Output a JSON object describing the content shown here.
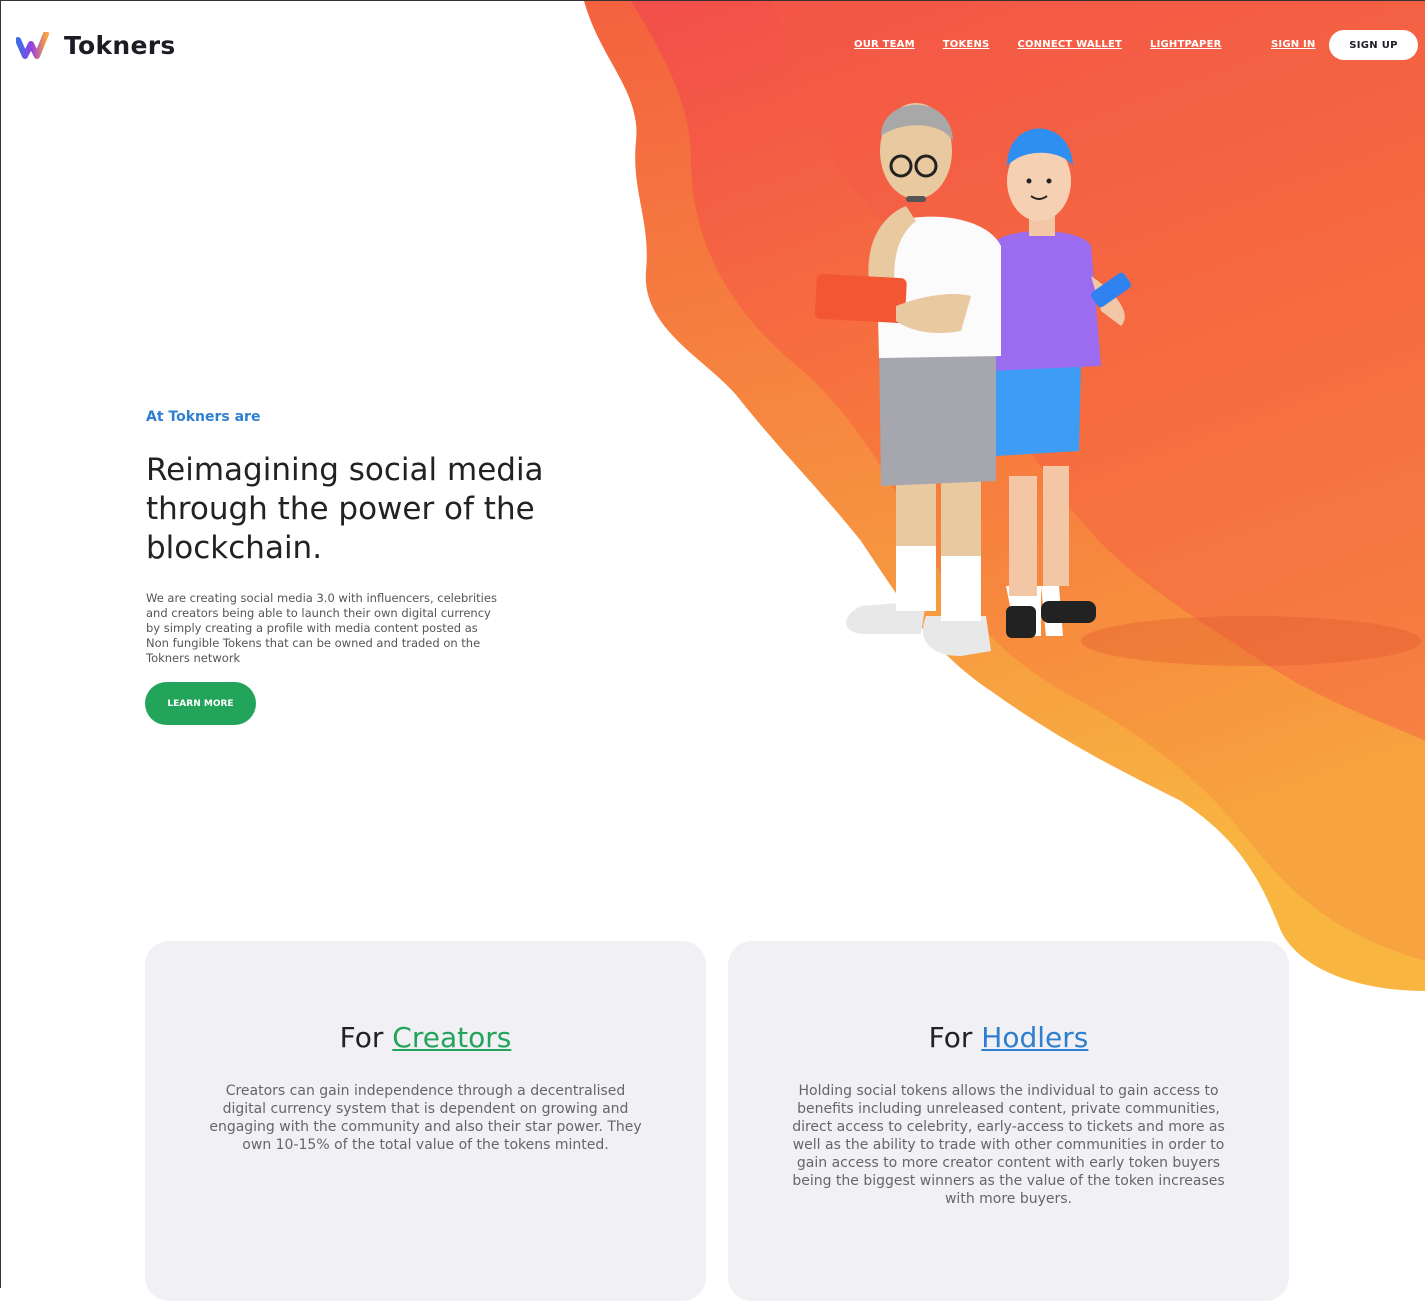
{
  "brand": {
    "name": "Tokners",
    "accent": "#22a45a",
    "blue": "#2f7fd1",
    "orange_top": "#f2544a",
    "orange_bottom": "#f7b13f"
  },
  "nav": {
    "items": [
      "OUR TEAM",
      "TOKENS",
      "CONNECT WALLET",
      "LIGHTPAPER"
    ],
    "sign_in": "SIGN IN",
    "sign_up": "SIGN UP"
  },
  "hero": {
    "eyebrow": "At Tokners are",
    "headline": "Reimagining social media through the power of the blockchain.",
    "description": "We are creating social media 3.0 with influencers, celebrities and creators being able to launch their own digital currency by simply creating a profile with media content posted as Non fungible Tokens that can be owned and traded on the Tokners network",
    "cta": "LEARN MORE",
    "illustration": "two-people-with-devices-illustration"
  },
  "cards": [
    {
      "prefix": "For",
      "highlight": "Creators",
      "body": "Creators can gain independence through a decentralised digital currency system that is dependent on growing and engaging with the community and also their star power. They own 10-15% of the total value of the tokens minted."
    },
    {
      "prefix": "For",
      "highlight": "Hodlers",
      "body": "Holding social tokens allows the individual to gain access to benefits including unreleased content, private communities, direct access to celebrity, early-access to tickets and more as well as the ability to trade with other communities in order to gain access to more creator content with early token buyers being the biggest winners as the value of the token increases with more buyers."
    }
  ]
}
